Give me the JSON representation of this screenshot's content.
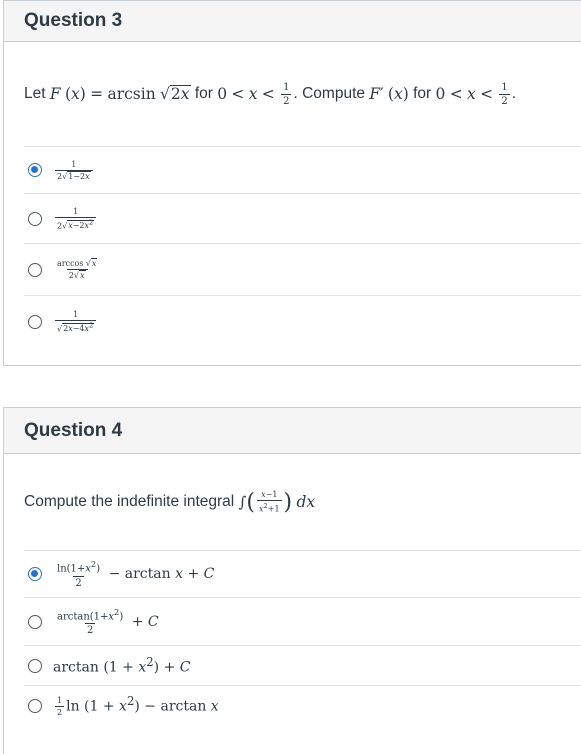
{
  "questions": [
    {
      "title": "Question 3",
      "prompt_prefix": "Let",
      "prompt_function": "F (x) = arcsin √2x",
      "prompt_mid": "for",
      "prompt_domain": "0 < x < ½",
      "prompt_compute": ". Compute",
      "prompt_derivative": "F′ (x)",
      "prompt_suffix": "for",
      "prompt_domain2": "0 < x < ½",
      "prompt_end": ".",
      "answers": [
        {
          "expr": "1 / (2√(1−2x))",
          "selected": true
        },
        {
          "expr": "1 / (2√(x−2x²))",
          "selected": false
        },
        {
          "expr": "arccos √x / (2√x)",
          "selected": false
        },
        {
          "expr": "1 / √(2x−4x²)",
          "selected": false
        }
      ]
    },
    {
      "title": "Question 4",
      "prompt_text": "Compute the indefinite integral",
      "prompt_integral": "∫ ((x−1)/(x²+1)) dx",
      "answers": [
        {
          "expr": "ln(1+x²)/2 − arctan x + C",
          "selected": true
        },
        {
          "expr": "arctan(1+x²)/2 + C",
          "selected": false
        },
        {
          "expr": "arctan (1 + x²) + C",
          "selected": false
        },
        {
          "expr": "½ ln(1 + x²) − arctan x",
          "selected": false
        }
      ]
    }
  ],
  "colors": {
    "accent": "#2d72c2",
    "header_bg": "#f5f5f5",
    "border": "#c7cdd1",
    "text": "#2d3b45"
  }
}
